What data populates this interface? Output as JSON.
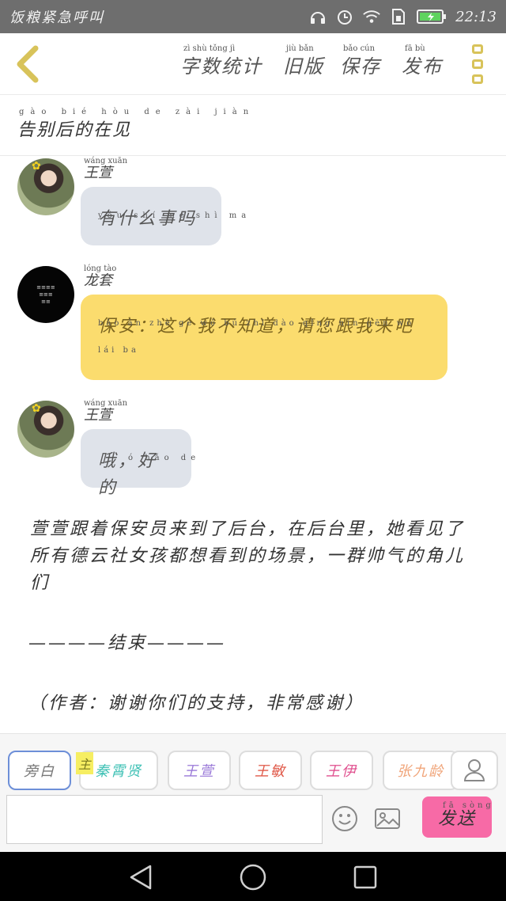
{
  "status_bar": {
    "app_title": "饭粮紧急呼叫",
    "time": "22:13"
  },
  "header": {
    "actions": [
      {
        "label": "字数统计",
        "pinyin": "zì shù tǒng jì"
      },
      {
        "label": "旧版",
        "pinyin": "jiù bǎn"
      },
      {
        "label": "保存",
        "pinyin": "bǎo cún"
      },
      {
        "label": "发布",
        "pinyin": "fā bù"
      }
    ]
  },
  "chapter": {
    "title": "告别后的在见",
    "title_pinyin": "gào bié hòu de zài jiàn"
  },
  "messages": [
    {
      "sender": "王萱",
      "sender_pinyin": "wáng xuān",
      "text": "有什么事吗",
      "text_pinyin": "yǒu shí me shì ma",
      "avatar": "girl",
      "style": "gray"
    },
    {
      "sender": "龙套",
      "sender_pinyin": "lóng tào",
      "text": "保安：这个我不知道，请您跟我来吧",
      "text_pinyin": "bǎo ān zhè gè wǒ bú zhī dào qǐng nín gēn wǒ lái ba",
      "avatar": "dark",
      "style": "yellow"
    },
    {
      "sender": "王萱",
      "sender_pinyin": "wáng xuān",
      "text": "哦，好的",
      "text_pinyin": "ó hǎo de",
      "avatar": "girl",
      "style": "gray"
    }
  ],
  "narration": "萱萱跟着保安员来到了后台，在后台里，她看见了所有德云社女孩都想看到的场景，一群帅气的角儿们",
  "ending": "————结束————",
  "credit": "（作者：谢谢你们的支持，非常感谢）",
  "roles": {
    "tag": "主",
    "items": [
      {
        "label": "旁白",
        "color": "#777777"
      },
      {
        "label": "秦霄贤",
        "color": "#3fc1b5"
      },
      {
        "label": "王萱",
        "color": "#9a79d8"
      },
      {
        "label": "王敏",
        "color": "#e05a4a"
      },
      {
        "label": "王伊",
        "color": "#e0508f"
      },
      {
        "label": "张九龄",
        "color": "#f0a57a"
      }
    ]
  },
  "composer": {
    "input_value": "",
    "send_label": "发送",
    "send_pinyin": "fā sòng"
  }
}
